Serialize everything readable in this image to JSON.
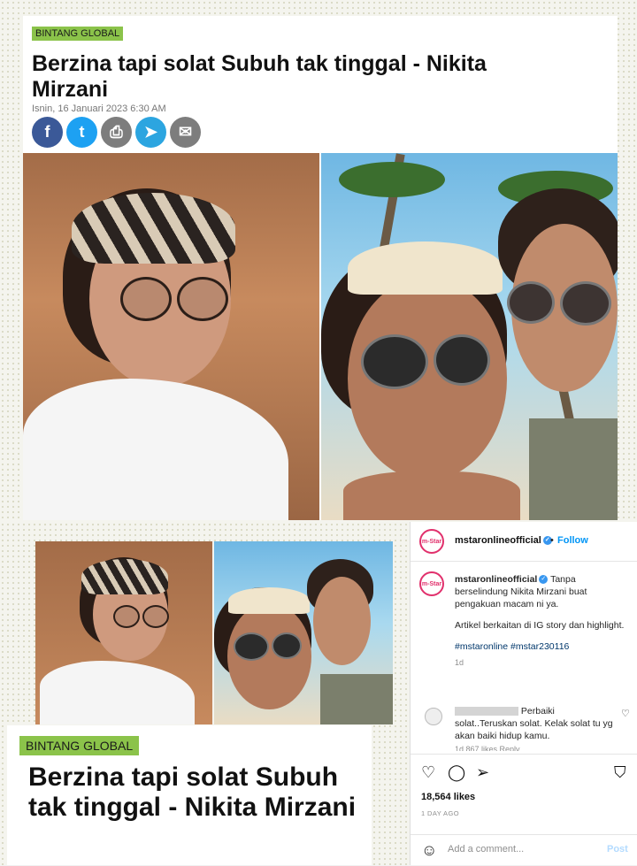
{
  "top_article": {
    "category": "BINTANG GLOBAL",
    "title": "Berzina tapi solat Subuh tak tinggal - Nikita Mirzani",
    "date": "Isnin, 16 Januari 2023 6:30 AM",
    "share_icons": [
      "facebook-icon",
      "twitter-icon",
      "print-icon",
      "telegram-icon",
      "email-icon"
    ],
    "share_colors": [
      "#3b5998",
      "#1da1f2",
      "#7d7d7d",
      "#2ca5e0",
      "#7d7d7d"
    ],
    "share_glyphs": [
      "f",
      "t",
      "⎙",
      "➤",
      "✉"
    ]
  },
  "bottom_article": {
    "category": "BINTANG GLOBAL",
    "title": "Berzina tapi solat Subuh tak tinggal - Nikita Mirzani"
  },
  "instagram": {
    "avatar_text": "m-Star",
    "username": "mstaronlineofficial",
    "verified": "✓",
    "follow_separator": "•",
    "follow": "Follow",
    "caption_user": "mstaronlineofficial",
    "caption_line1": "Tanpa berselindung Nikita Mirzani buat pengakuan macam ni ya.",
    "caption_line2": "Artikel berkaitan di IG story dan highlight.",
    "hashtags": "#mstaronline #mstar230116",
    "caption_age": "1d",
    "comment_text": "Perbaiki solat..Teruskan solat. Kelak solat tu yg akan baiki hidup kamu.",
    "comment_meta": "1d   867 likes   Reply",
    "likes": "18,564 likes",
    "posted": "1 DAY AGO",
    "add_comment_placeholder": "Add a comment...",
    "post_label": "Post"
  }
}
